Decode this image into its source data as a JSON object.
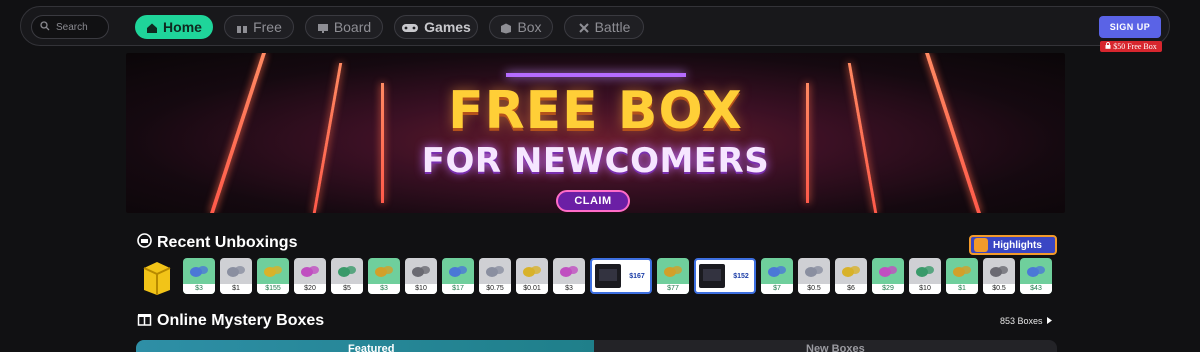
{
  "nav": {
    "search_placeholder": "Search",
    "tabs": [
      {
        "label": "Home",
        "icon": "home-icon",
        "active": true
      },
      {
        "label": "Free",
        "icon": "gift-icon",
        "active": false
      },
      {
        "label": "Board",
        "icon": "board-icon",
        "active": false
      },
      {
        "label": "Games",
        "icon": "gamepad-icon",
        "active": false
      },
      {
        "label": "Box",
        "icon": "box-icon",
        "active": false
      },
      {
        "label": "Battle",
        "icon": "swords-icon",
        "active": false
      }
    ],
    "signup": "SIGN UP",
    "free_badge": "$50 Free Box"
  },
  "banner": {
    "line1": "FREE BOX",
    "line2": "FOR NEWCOMERS",
    "cta": "CLAIM"
  },
  "recent": {
    "title": "Recent Unboxings",
    "highlights": "Highlights",
    "items": [
      {
        "price": "$3",
        "style": "g"
      },
      {
        "price": "$1",
        "style": "s"
      },
      {
        "price": "$155",
        "style": "g"
      },
      {
        "price": "$20",
        "style": "s"
      },
      {
        "price": "$5",
        "style": "s"
      },
      {
        "price": "$3",
        "style": "g"
      },
      {
        "price": "$10",
        "style": "s"
      },
      {
        "price": "$17",
        "style": "g"
      },
      {
        "price": "$0.75",
        "style": "s"
      },
      {
        "price": "$0.01",
        "style": "s"
      },
      {
        "price": "$3",
        "style": "s"
      },
      {
        "price": "$167",
        "style": "wide"
      },
      {
        "price": "$77",
        "style": "g"
      },
      {
        "price": "$152",
        "style": "wide"
      },
      {
        "price": "$7",
        "style": "g"
      },
      {
        "price": "$0.5",
        "style": "s"
      },
      {
        "price": "$6",
        "style": "s"
      },
      {
        "price": "$29",
        "style": "g"
      },
      {
        "price": "$10",
        "style": "s"
      },
      {
        "price": "$1",
        "style": "g"
      },
      {
        "price": "$0.5",
        "style": "s"
      },
      {
        "price": "$43",
        "style": "g"
      }
    ]
  },
  "mystery": {
    "title": "Online Mystery Boxes",
    "count": "853 Boxes",
    "tabs": [
      "Featured",
      "New Boxes"
    ]
  },
  "colors": {
    "accent": "#1fd59a",
    "signup": "#5a63e6",
    "badge": "#d7262e"
  }
}
